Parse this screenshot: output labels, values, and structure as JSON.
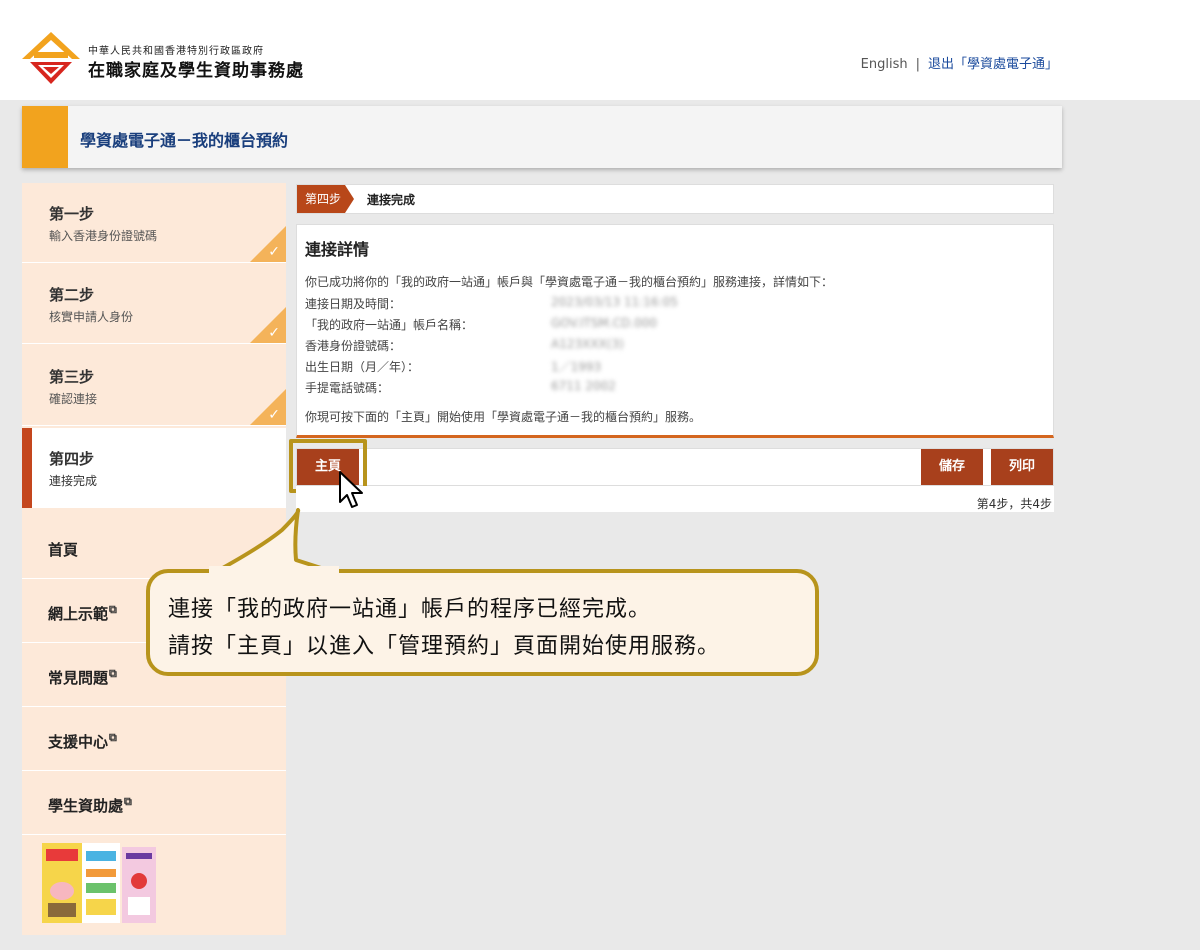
{
  "header": {
    "org_sub": "中華人民共和國香港特別行政區政府",
    "org_main": "在職家庭及學生資助事務處",
    "lang_link": "English",
    "separator": "|",
    "logout_link": "退出「學資處電子通」"
  },
  "page_title": "學資處電子通－我的櫃台預約",
  "steps": [
    {
      "num": "第一步",
      "desc": "輸入香港身份證號碼",
      "done": true
    },
    {
      "num": "第二步",
      "desc": "核實申請人身份",
      "done": true
    },
    {
      "num": "第三步",
      "desc": "確認連接",
      "done": true
    },
    {
      "num": "第四步",
      "desc": "連接完成",
      "active": true
    }
  ],
  "nav": [
    {
      "label": "首頁"
    },
    {
      "label": "網上示範",
      "external": true
    },
    {
      "label": "常見問題",
      "external": true
    },
    {
      "label": "支援中心",
      "external": true
    },
    {
      "label": "學生資助處",
      "external": true
    }
  ],
  "stepbar": {
    "badge": "第四步",
    "title": "連接完成"
  },
  "details": {
    "title": "連接詳情",
    "intro": "你已成功將你的「我的政府一站通」帳戶與「學資處電子通－我的櫃台預約」服務連接，詳情如下：",
    "rows": [
      {
        "label": "連接日期及時間：",
        "value": "2023/03/13 11:16:05"
      },
      {
        "label": "「我的政府一站通」帳戶名稱：",
        "value": "GOV.ITSM.CD.000"
      },
      {
        "label": "香港身份證號碼：",
        "value": "A123XXX(3)"
      },
      {
        "label": "出生日期（月／年）：",
        "value": "1／1993"
      },
      {
        "label": "手提電話號碼：",
        "value": "6711 2002"
      }
    ],
    "outro": "你現可按下面的「主頁」開始使用「學資處電子通－我的櫃台預約」服務。"
  },
  "buttons": {
    "home": "主頁",
    "save": "儲存",
    "print": "列印"
  },
  "step_count": "第4步，共4步",
  "callout": {
    "line1": "連接「我的政府一站通」帳戶的程序已經完成。",
    "line2": "請按「主頁」以進入「管理預約」頁面開始使用服務。"
  },
  "colors": {
    "accent_orange": "#f2a31e",
    "button_red": "#a8401c",
    "highlight_gold": "#b8941c",
    "sidebar_bg": "#fde9d9"
  }
}
